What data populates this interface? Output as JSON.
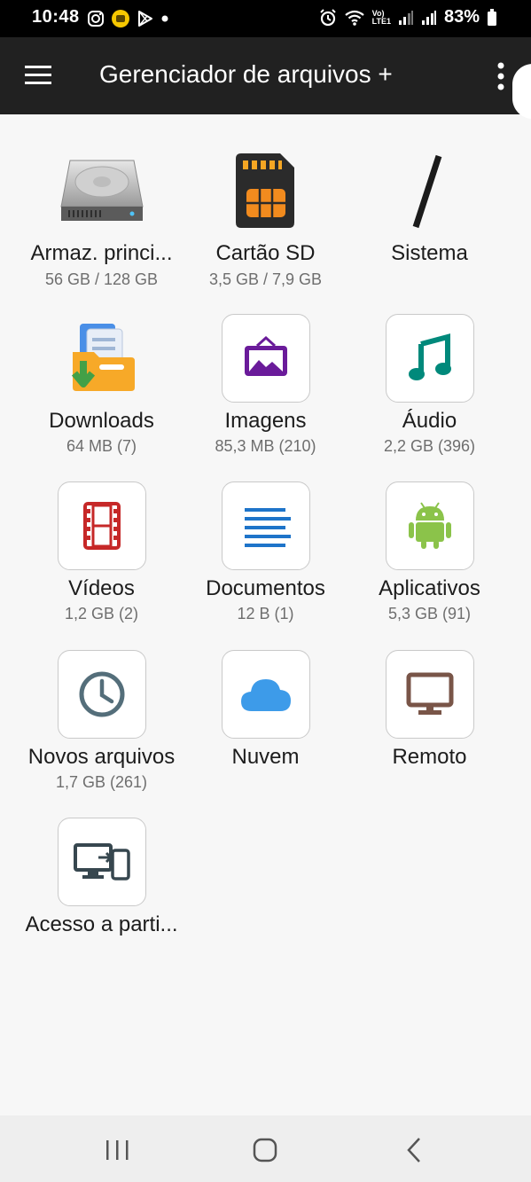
{
  "status_bar": {
    "time": "10:48",
    "battery": "83%",
    "left_icons": [
      "instagram-icon",
      "emoji-notification-icon",
      "play-store-icon",
      "dot-icon"
    ],
    "right_icons": [
      "alarm-icon",
      "wifi-icon",
      "volte-icon",
      "signal-icon",
      "signal-icon",
      "battery-icon"
    ],
    "volte_top": "Vo)",
    "volte_bottom": "LTE1"
  },
  "app_bar": {
    "title": "Gerenciador de arquivos +",
    "menu_icon": "hamburger-icon",
    "overflow_icon": "more-vert-icon"
  },
  "tiles": [
    {
      "label": "Armaz. princi...",
      "sub": "56 GB / 128 GB",
      "icon": "hard-drive-icon"
    },
    {
      "label": "Cartão SD",
      "sub": "3,5 GB / 7,9 GB",
      "icon": "sd-card-icon"
    },
    {
      "label": "Sistema",
      "sub": "",
      "icon": "root-slash-icon"
    },
    {
      "label": "Downloads",
      "sub": "64 MB (7)",
      "icon": "downloads-folder-icon"
    },
    {
      "label": "Imagens",
      "sub": "85,3 MB (210)",
      "icon": "image-icon"
    },
    {
      "label": "Áudio",
      "sub": "2,2 GB (396)",
      "icon": "music-note-icon"
    },
    {
      "label": "Vídeos",
      "sub": "1,2 GB (2)",
      "icon": "film-icon"
    },
    {
      "label": "Documentos",
      "sub": "12 B (1)",
      "icon": "document-lines-icon"
    },
    {
      "label": "Aplicativos",
      "sub": "5,3 GB (91)",
      "icon": "android-icon"
    },
    {
      "label": "Novos arquivos",
      "sub": "1,7 GB (261)",
      "icon": "clock-icon"
    },
    {
      "label": "Nuvem",
      "sub": "",
      "icon": "cloud-icon"
    },
    {
      "label": "Remoto",
      "sub": "",
      "icon": "monitor-icon"
    },
    {
      "label": "Acesso a parti...",
      "sub": "",
      "icon": "pc-to-phone-icon"
    }
  ],
  "nav_bar": {
    "recents_icon": "recents-icon",
    "home_icon": "home-icon",
    "back_icon": "back-icon"
  },
  "colors": {
    "app_bar": "#212121",
    "background": "#f7f7f7",
    "image_purple": "#6a1b9a",
    "audio_teal": "#00897b",
    "video_red": "#c62828",
    "docs_blue": "#1e74c9",
    "android_green": "#8bc34a",
    "clock_slate": "#546e7a",
    "cloud_blue": "#3d9be9",
    "remote_brown": "#795548",
    "access_slate": "#37474f"
  }
}
